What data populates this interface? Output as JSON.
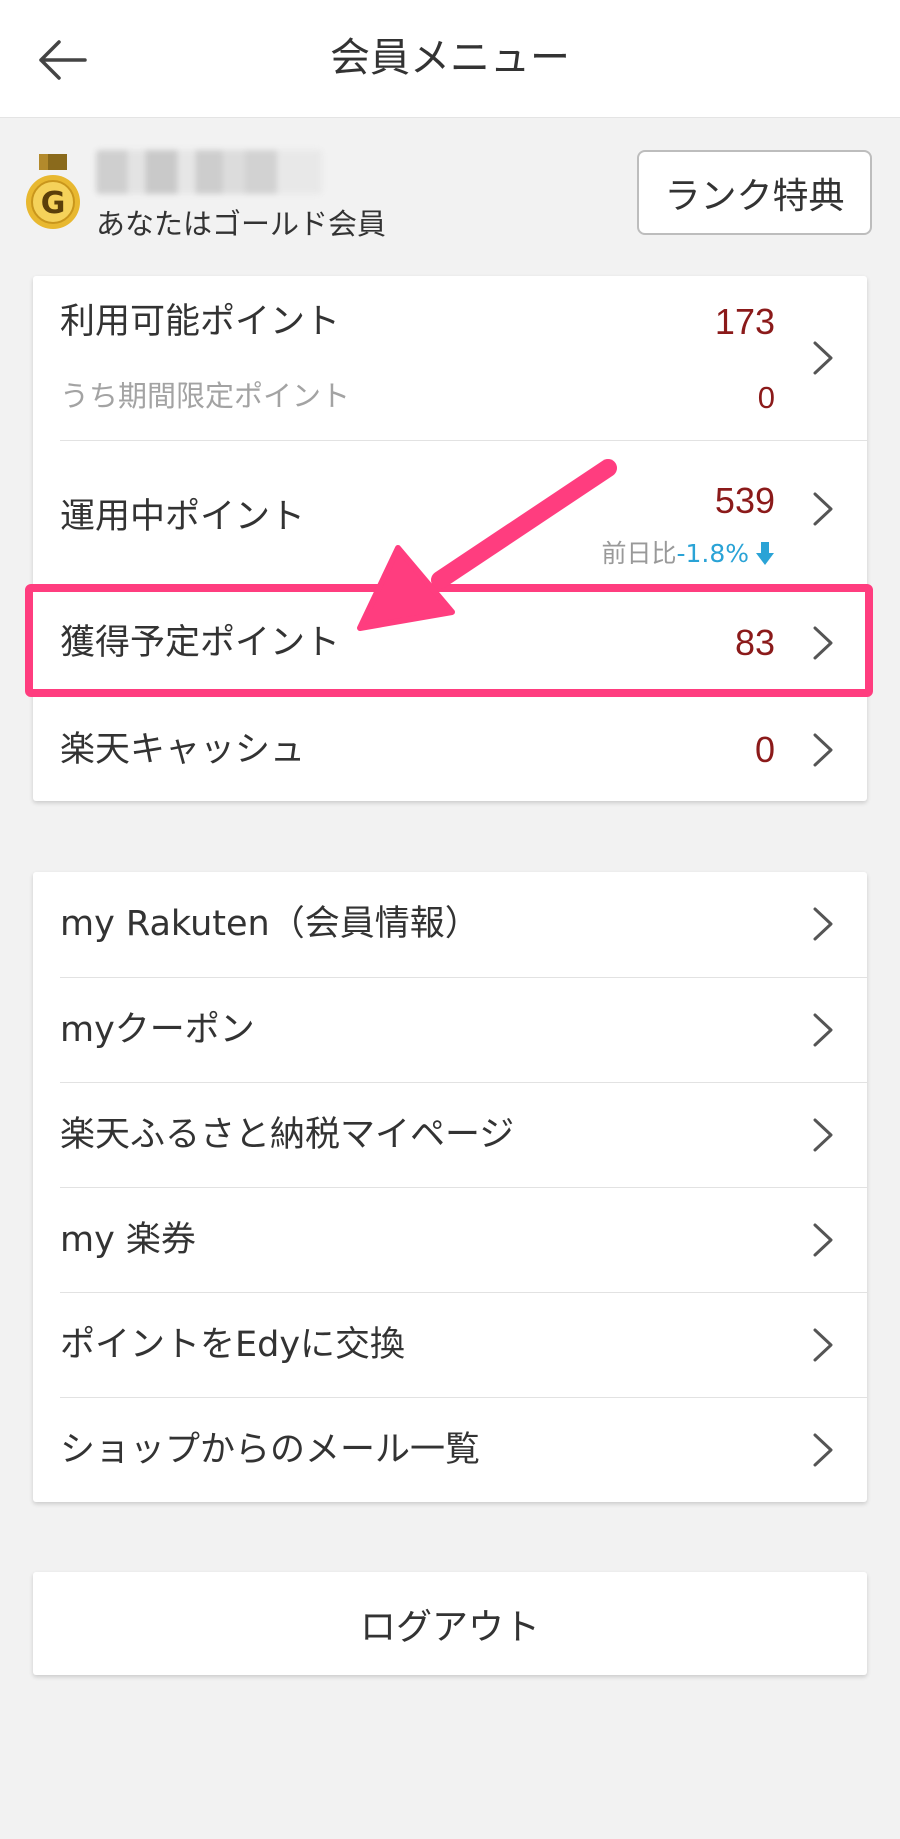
{
  "header": {
    "title": "会員メニュー",
    "back_icon": "arrow-left-icon"
  },
  "profile": {
    "medal_letter": "G",
    "rank_text": "あなたはゴールド会員",
    "rank_button": "ランク特典"
  },
  "points": {
    "available": {
      "label": "利用可能ポイント",
      "value": "173",
      "sub_label": "うち期間限定ポイント",
      "sub_value": "0"
    },
    "invested": {
      "label": "運用中ポイント",
      "value": "539",
      "delta_label": "前日比",
      "delta_value": "-1.8%"
    },
    "pending": {
      "label": "獲得予定ポイント",
      "value": "83"
    },
    "cash": {
      "label": "楽天キャッシュ",
      "value": "0"
    }
  },
  "menu": {
    "items": [
      {
        "label": "my Rakuten（会員情報）"
      },
      {
        "label": "myクーポン"
      },
      {
        "label": "楽天ふるさと納税マイページ"
      },
      {
        "label": "my 楽券"
      },
      {
        "label": "ポイントをEdyに交換"
      },
      {
        "label": "ショップからのメール一覧"
      }
    ]
  },
  "logout": {
    "label": "ログアウト"
  },
  "colors": {
    "value_red": "#8b1a1a",
    "highlight_pink": "#ff3d7f",
    "delta_blue": "#2aa3d6",
    "medal_gold": "#e8b830"
  }
}
